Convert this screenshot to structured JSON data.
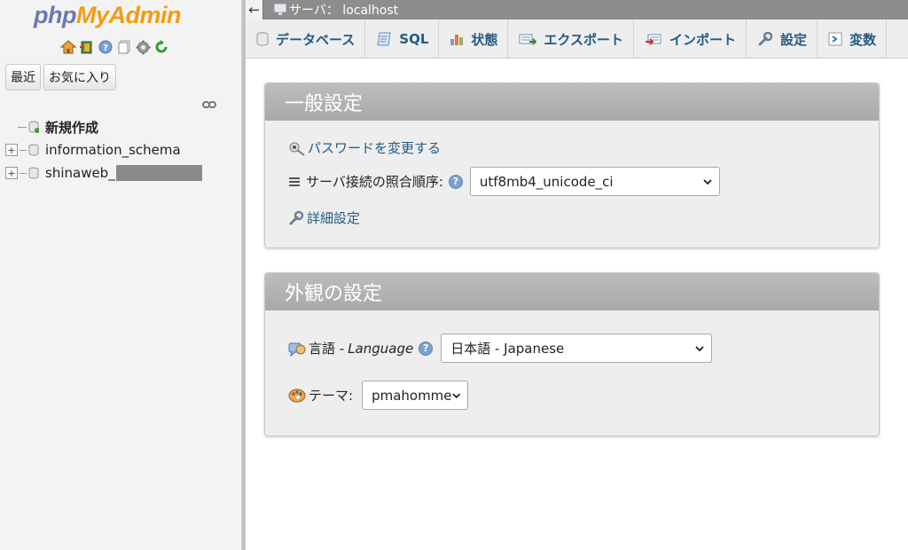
{
  "nav": {
    "logo": {
      "php": "php",
      "my": "My",
      "admin": "Admin"
    },
    "quick_icons": [
      "home-icon",
      "exit-icon",
      "help-icon",
      "docs-icon",
      "settings-gear-icon",
      "reload-icon"
    ],
    "tabs": [
      "最近",
      "お気に入り"
    ],
    "tree": [
      {
        "label": "新規作成"
      },
      {
        "label": "information_schema",
        "expand": "+"
      },
      {
        "label": "shinaweb_",
        "expand": "+"
      }
    ]
  },
  "serverbar": {
    "back": "←",
    "label": "サーバ： localhost"
  },
  "tabs": [
    {
      "label": "データベース",
      "icon": "database-icon"
    },
    {
      "label": "SQL",
      "icon": "sql-icon"
    },
    {
      "label": "状態",
      "icon": "status-icon"
    },
    {
      "label": "エクスポート",
      "icon": "export-icon"
    },
    {
      "label": "インポート",
      "icon": "import-icon"
    },
    {
      "label": "設定",
      "icon": "settings-icon"
    },
    {
      "label": "変数",
      "icon": "variables-icon"
    }
  ],
  "general": {
    "title": "一般設定",
    "password_link": "パスワードを変更する",
    "collation_label": "サーバ接続の照合順序:",
    "collation_value": "utf8mb4_unicode_ci",
    "more_settings_link": "詳細設定"
  },
  "appearance": {
    "title": "外観の設定",
    "language_label": "言語 - ",
    "language_label_en": "Language",
    "language_value": "日本語 - Japanese",
    "theme_label": "テーマ:",
    "theme_value": "pmahomme"
  },
  "colors": {
    "link": "#235a81",
    "panel_head": "#b0b0b0",
    "server_bar": "#8d8d8d",
    "logo_blue": "#6c78af",
    "logo_orange": "#f29c11"
  }
}
